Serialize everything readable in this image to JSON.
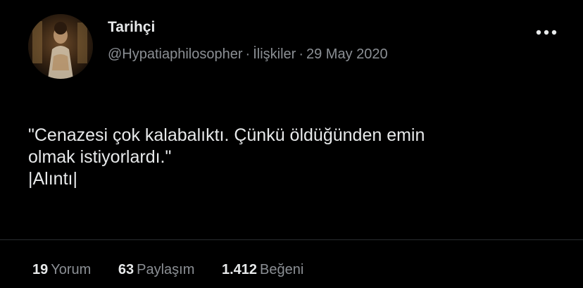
{
  "author": {
    "name": "Tarihçi",
    "handle": "@Hypatiaphilosopher",
    "community": "İlişkiler",
    "date": "29 May 2020",
    "separator": "·"
  },
  "menu": {
    "icon": "more-horizontal-icon"
  },
  "tweet": {
    "lines": [
      "\"Cenazesi çok kalabalıktı. Çünkü öldüğünden emin",
      "olmak istiyorlardı.\"",
      "|Alıntı|"
    ]
  },
  "stats": {
    "replies": {
      "count": "19",
      "label": "Yorum"
    },
    "retweets": {
      "count": "63",
      "label": "Paylaşım"
    },
    "likes": {
      "count": "1.412",
      "label": "Beğeni"
    }
  },
  "colors": {
    "background": "#000000",
    "primary_text": "#e7e9ea",
    "secondary_text": "#8b8f94",
    "divider": "#2a2d31"
  }
}
